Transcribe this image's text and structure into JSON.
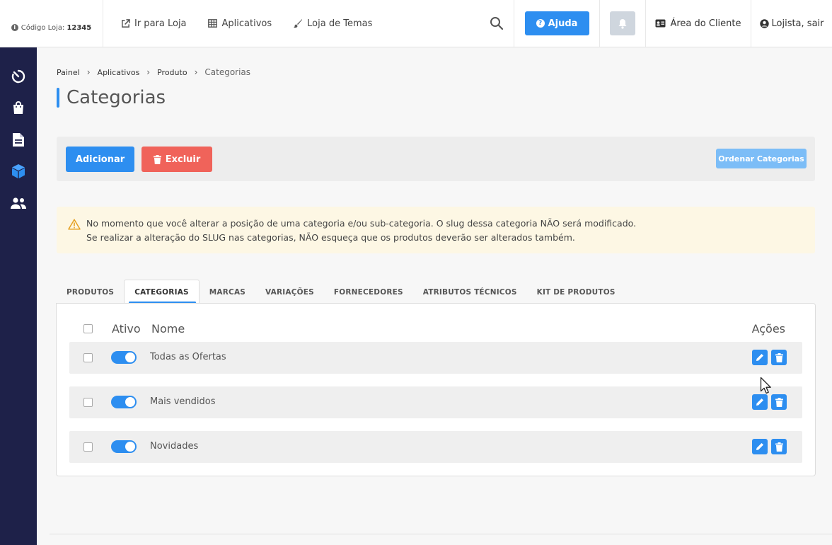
{
  "topbar": {
    "store_code_label": "Código Loja:",
    "store_code_value": "12345",
    "nav": [
      {
        "label": "Ir para Loja",
        "icon": "external-link-icon"
      },
      {
        "label": "Aplicativos",
        "icon": "grid-icon"
      },
      {
        "label": "Loja de Temas",
        "icon": "brush-icon"
      }
    ],
    "help_label": "Ajuda",
    "client_area_label": "Área do Cliente",
    "user_label": "Lojista, sair"
  },
  "sidebar": {
    "items": [
      {
        "icon": "dashboard-timer-icon",
        "active": false
      },
      {
        "icon": "shopping-bag-icon",
        "active": false
      },
      {
        "icon": "document-icon",
        "active": false
      },
      {
        "icon": "box-icon",
        "active": true
      },
      {
        "icon": "users-icon",
        "active": false
      }
    ]
  },
  "breadcrumb": [
    "Painel",
    "Aplicativos",
    "Produto",
    "Categorias"
  ],
  "page_title": "Categorias",
  "toolbar": {
    "add_label": "Adicionar",
    "delete_label": "Excluir",
    "order_label": "Ordenar Categorias"
  },
  "alert": {
    "line1": "No momento que você alterar a posição de uma categoria e/ou sub-categoria. O slug dessa categoria NÃO será modificado.",
    "line2": "Se realizar a alteração do SLUG nas categorias, NÃO esqueça que os produtos deverão ser alterados também."
  },
  "tabs": [
    {
      "label": "PRODUTOS",
      "active": false
    },
    {
      "label": "CATEGORIAS",
      "active": true
    },
    {
      "label": "MARCAS",
      "active": false
    },
    {
      "label": "VARIAÇÕES",
      "active": false
    },
    {
      "label": "FORNECEDORES",
      "active": false
    },
    {
      "label": "ATRIBUTOS TÉCNICOS",
      "active": false
    },
    {
      "label": "KIT DE PRODUTOS",
      "active": false
    }
  ],
  "table": {
    "headers": {
      "active": "Ativo",
      "name": "Nome",
      "actions": "Ações"
    },
    "rows": [
      {
        "name": "Todas as Ofertas",
        "active": true
      },
      {
        "name": "Mais vendidos",
        "active": true
      },
      {
        "name": "Novidades",
        "active": true
      }
    ]
  },
  "colors": {
    "primary": "#2d8ef0",
    "danger": "#f0635a",
    "sidebar": "#1e2149",
    "alert_bg": "#fdf7e4"
  }
}
